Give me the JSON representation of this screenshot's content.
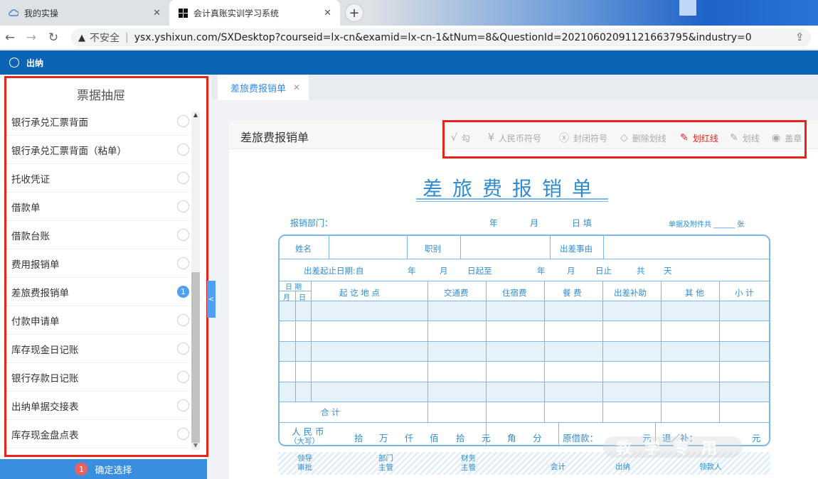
{
  "browser": {
    "tabs": [
      {
        "title": "我的实操",
        "icon": "cloud-icon"
      },
      {
        "title": "会计真账实训学习系统",
        "icon": "windows-logo-icon",
        "active": true
      }
    ],
    "insecure_label": "不安全",
    "url": "ysx.yshixun.com/SXDesktop?courseid=lx-cn&examid=lx-cn-1&tNum=8&QuestionId=20210602091121663795&industry=0"
  },
  "app": {
    "role_label": "出纳"
  },
  "drawer": {
    "title": "票据抽屉",
    "items": [
      {
        "label": "银行承兑汇票背面",
        "selected": false
      },
      {
        "label": "银行承兑汇票背面（粘单）",
        "selected": false
      },
      {
        "label": "托收凭证",
        "selected": false
      },
      {
        "label": "借款单",
        "selected": false
      },
      {
        "label": "借款台账",
        "selected": false
      },
      {
        "label": "费用报销单",
        "selected": false
      },
      {
        "label": "差旅费报销单",
        "selected": true,
        "badge": "1"
      },
      {
        "label": "付款申请单",
        "selected": false
      },
      {
        "label": "库存现金日记账",
        "selected": false
      },
      {
        "label": "银行存款日记账",
        "selected": false
      },
      {
        "label": "出纳单据交接表",
        "selected": false
      },
      {
        "label": "库存现金盘点表",
        "selected": false
      }
    ],
    "confirm_count": "1",
    "confirm_label": "确定选择",
    "collapse_label": "<"
  },
  "content": {
    "tab_label": "差旅费报销单",
    "panel_title": "差旅费报销单",
    "tools": [
      {
        "icon": "check-icon",
        "glyph": "√",
        "label": "勾",
        "color": "#aaaaaa"
      },
      {
        "icon": "yuan-icon",
        "glyph": "¥",
        "label": "人民币符号",
        "color": "#aaaaaa"
      },
      {
        "icon": "close-circle-icon",
        "glyph": "ⓧ",
        "label": "封闭符号",
        "color": "#aaaaaa"
      },
      {
        "icon": "eraser-icon",
        "glyph": "◇",
        "label": "删除划线",
        "color": "#aaaaaa"
      },
      {
        "icon": "red-pen-icon",
        "glyph": "✎",
        "label": "划红线",
        "color": "#e8231c"
      },
      {
        "icon": "pen-icon",
        "glyph": "✎",
        "label": "划线",
        "color": "#aaaaaa"
      },
      {
        "icon": "stamp-icon",
        "glyph": "◉",
        "label": "盖章",
        "color": "#aaaaaa"
      }
    ]
  },
  "form": {
    "title": "差旅费报销单",
    "dept_label": "报销部门：",
    "date_year": "年",
    "date_month": "月",
    "date_day": "日 填",
    "attachments": "单据及附件共 ______ 张",
    "name_label": "姓名",
    "position_label": "职别",
    "reason_label": "出差事由",
    "period_from": "出差起止日期:自",
    "period_year": "年",
    "period_month": "月",
    "period_start": "日起至",
    "period_year2": "年",
    "period_month2": "月",
    "period_end": "日止",
    "period_total": "共",
    "period_days": "天",
    "col_date": "日 期",
    "col_month": "月",
    "col_day": "日",
    "col_route": "起 讫 地 点",
    "col_transport": "交通费",
    "col_lodging": "住宿费",
    "col_meals": "餐 费",
    "col_allowance": "出差补助",
    "col_other": "其 他",
    "col_subtotal": "小 计",
    "total_label": "合        计",
    "rmb_label": "人 民 币",
    "rmb_sub": "（大写）",
    "units": [
      "拾",
      "万",
      "仟",
      "佰",
      "拾",
      "元",
      "角",
      "分"
    ],
    "advance_label": "原借款：",
    "advance_unit": "元",
    "refund_label": "退／补：",
    "refund_unit": "元",
    "sign_leader": "领导\n审批",
    "sign_dept": "部门\n主管",
    "sign_finance": "财务\n主管",
    "sign_accountant": "会计",
    "sign_cashier": "出纳",
    "sign_receiver": "领款人",
    "watermark": "教学专用"
  }
}
